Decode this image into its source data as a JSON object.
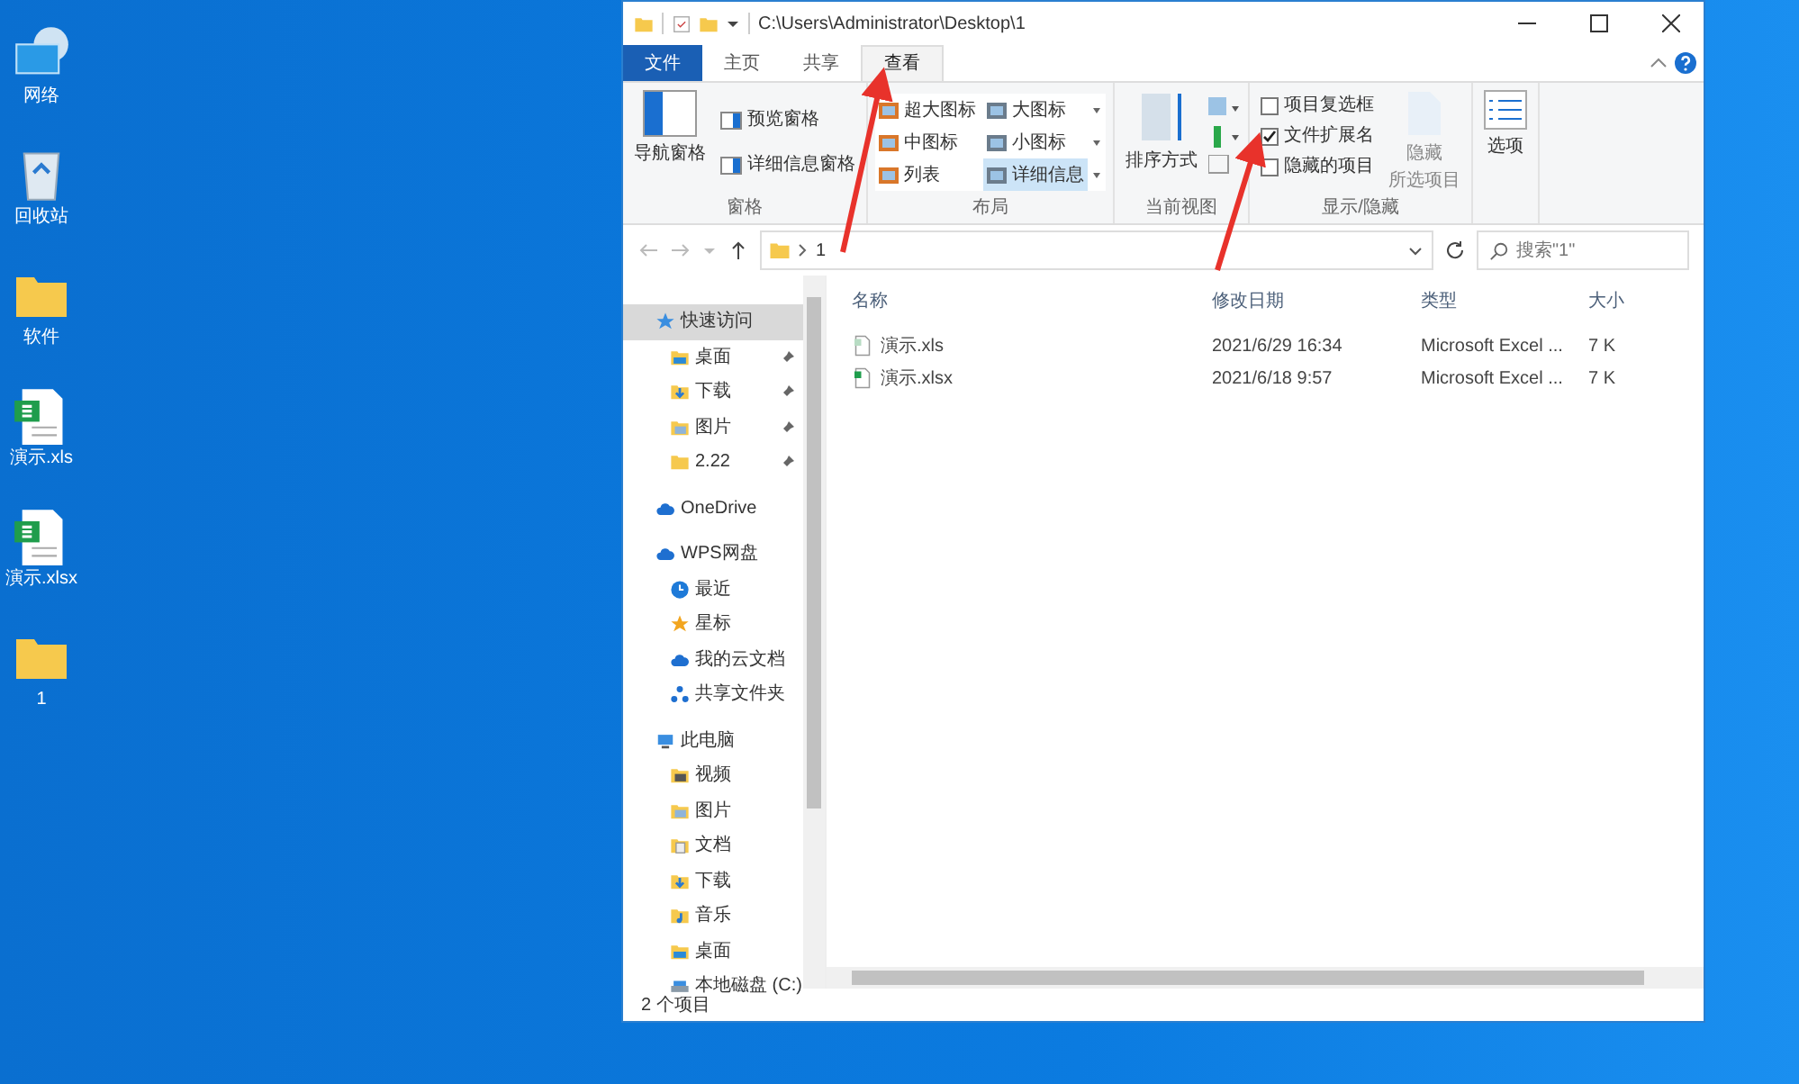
{
  "desktop_icons": [
    {
      "label": "网络",
      "kind": "network"
    },
    {
      "label": "回收站",
      "kind": "recycle"
    },
    {
      "label": "软件",
      "kind": "folder"
    },
    {
      "label": "演示.xls",
      "kind": "sheet"
    },
    {
      "label": "演示.xlsx",
      "kind": "sheet"
    },
    {
      "label": "1",
      "kind": "folder"
    }
  ],
  "window": {
    "title": "C:\\Users\\Administrator\\Desktop\\1"
  },
  "ribbon_tabs": [
    {
      "label": "文件",
      "kind": "file",
      "selected": false
    },
    {
      "label": "主页",
      "kind": "tab",
      "selected": false
    },
    {
      "label": "共享",
      "kind": "tab",
      "selected": false
    },
    {
      "label": "查看",
      "kind": "tab",
      "selected": true
    }
  ],
  "ribbon": {
    "panes": {
      "title": "窗格",
      "large": "导航窗格",
      "small": [
        "预览窗格",
        "详细信息窗格"
      ]
    },
    "layout": {
      "title": "布局",
      "options": [
        {
          "label": "超大图标",
          "selected": false
        },
        {
          "label": "大图标",
          "selected": false
        },
        {
          "label": "中图标",
          "selected": false
        },
        {
          "label": "小图标",
          "selected": false
        },
        {
          "label": "列表",
          "selected": false
        },
        {
          "label": "详细信息",
          "selected": true
        }
      ]
    },
    "current_view": {
      "title": "当前视图",
      "sort": "排序方式"
    },
    "show_hide": {
      "title": "显示/隐藏",
      "checkboxes": [
        {
          "label": "项目复选框",
          "checked": false
        },
        {
          "label": "文件扩展名",
          "checked": true
        },
        {
          "label": "隐藏的项目",
          "checked": false
        }
      ],
      "hide_selected": [
        "隐藏",
        "所选项目"
      ]
    },
    "options": {
      "label": "选项"
    }
  },
  "address": {
    "path": [
      "1"
    ],
    "search_placeholder": "搜索\"1\""
  },
  "nav": [
    {
      "label": "快速访问",
      "kind": "star",
      "selected": true,
      "children": [
        {
          "label": "桌面",
          "kind": "desktop",
          "pinned": true,
          "selected": false
        },
        {
          "label": "下载",
          "kind": "download",
          "pinned": true,
          "selected": false
        },
        {
          "label": "图片",
          "kind": "picture",
          "pinned": true,
          "selected": false
        },
        {
          "label": "2.22",
          "kind": "folder",
          "pinned": true,
          "selected": false
        }
      ]
    },
    {
      "label": "OneDrive",
      "kind": "cloud",
      "selected": false
    },
    {
      "label": "WPS网盘",
      "kind": "cloud",
      "selected": false,
      "children": [
        {
          "label": "最近",
          "kind": "clock",
          "selected": false
        },
        {
          "label": "星标",
          "kind": "goldstar",
          "selected": false
        },
        {
          "label": "我的云文档",
          "kind": "cloud",
          "selected": false
        },
        {
          "label": "共享文件夹",
          "kind": "share",
          "selected": false
        }
      ]
    },
    {
      "label": "此电脑",
      "kind": "pc",
      "selected": false,
      "children": [
        {
          "label": "视频",
          "kind": "video",
          "selected": false
        },
        {
          "label": "图片",
          "kind": "picture",
          "selected": false
        },
        {
          "label": "文档",
          "kind": "doc",
          "selected": false
        },
        {
          "label": "下载",
          "kind": "download",
          "selected": false
        },
        {
          "label": "音乐",
          "kind": "music",
          "selected": false
        },
        {
          "label": "桌面",
          "kind": "desktop",
          "selected": false
        },
        {
          "label": "本地磁盘 (C:)",
          "kind": "drive",
          "selected": false
        }
      ]
    }
  ],
  "files": {
    "columns": [
      "名称",
      "修改日期",
      "类型",
      "大小"
    ],
    "rows": [
      {
        "name": "演示.xls",
        "date": "2021/6/29 16:34",
        "type": "Microsoft Excel ...",
        "size": "7 K"
      },
      {
        "name": "演示.xlsx",
        "date": "2021/6/18 9:57",
        "type": "Microsoft Excel ...",
        "size": "7 K"
      }
    ]
  },
  "status_bar": {
    "text": "2 个项目"
  },
  "annotations": [
    {
      "kind": "arrow"
    },
    {
      "kind": "arrow"
    }
  ]
}
